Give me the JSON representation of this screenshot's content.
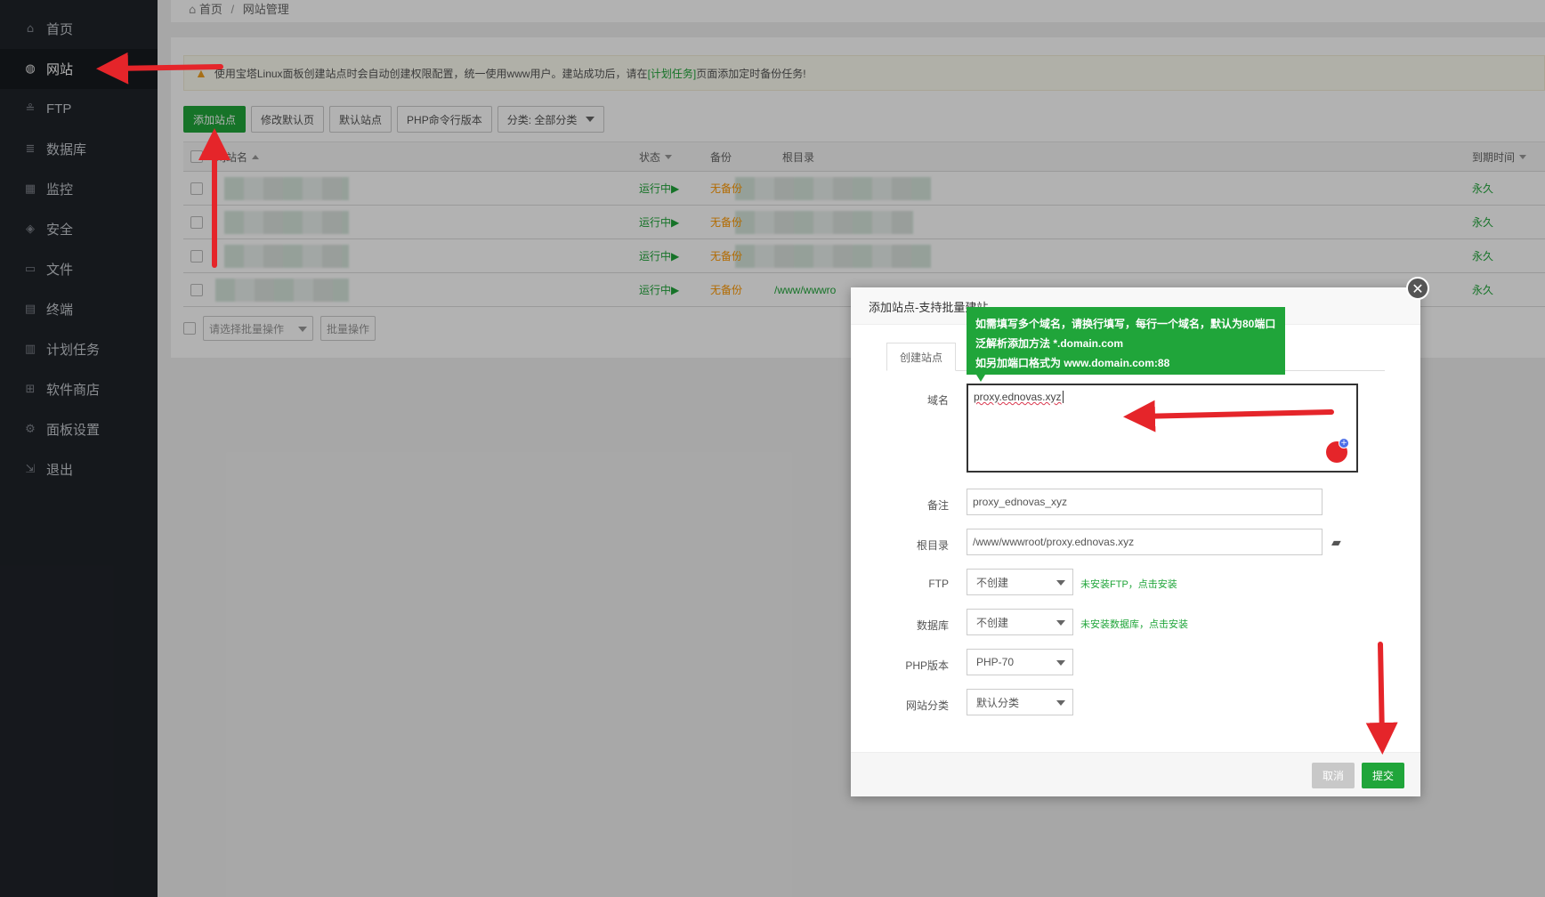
{
  "sidebar": {
    "items": [
      {
        "label": "首页",
        "icon": "home-icon",
        "glyph": "⌂"
      },
      {
        "label": "网站",
        "icon": "globe-icon",
        "glyph": "◍"
      },
      {
        "label": "FTP",
        "icon": "ftp-icon",
        "glyph": "≗"
      },
      {
        "label": "数据库",
        "icon": "database-icon",
        "glyph": "≣"
      },
      {
        "label": "监控",
        "icon": "monitor-icon",
        "glyph": "▦"
      },
      {
        "label": "安全",
        "icon": "shield-icon",
        "glyph": "◈"
      },
      {
        "label": "文件",
        "icon": "folder-icon",
        "glyph": "▭"
      },
      {
        "label": "终端",
        "icon": "terminal-icon",
        "glyph": "▤"
      },
      {
        "label": "计划任务",
        "icon": "calendar-icon",
        "glyph": "▥"
      },
      {
        "label": "软件商店",
        "icon": "grid-icon",
        "glyph": "⊞"
      },
      {
        "label": "面板设置",
        "icon": "gear-icon",
        "glyph": "⚙"
      },
      {
        "label": "退出",
        "icon": "logout-icon",
        "glyph": "⇲"
      }
    ],
    "active_index": 1
  },
  "breadcrumb": {
    "home": "首页",
    "sep": "/",
    "current": "网站管理"
  },
  "notice": {
    "text_before": "使用宝塔Linux面板创建站点时会自动创建权限配置，统一使用www用户。建站成功后，请在",
    "link": "[计划任务]",
    "text_after": "页面添加定时备份任务!"
  },
  "toolbar": {
    "add_site": "添加站点",
    "modify_default": "修改默认页",
    "default_site": "默认站点",
    "php_cli": "PHP命令行版本",
    "category": "分类: 全部分类"
  },
  "table": {
    "headers": {
      "name": "网站名",
      "status": "状态",
      "backup": "备份",
      "root": "根目录",
      "expire": "到期时间"
    },
    "rows": [
      {
        "status": "运行中▶",
        "backup": "无备份",
        "root": "",
        "expire": "永久"
      },
      {
        "status": "运行中▶",
        "backup": "无备份",
        "root": "",
        "expire": "永久"
      },
      {
        "status": "运行中▶",
        "backup": "无备份",
        "root": "",
        "expire": "永久"
      },
      {
        "status": "运行中▶",
        "backup": "无备份",
        "root": "/www/wwwro",
        "expire": "永久"
      }
    ]
  },
  "batch": {
    "select_placeholder": "请选择批量操作",
    "button": "批量操作"
  },
  "modal": {
    "title": "添加站点-支持批量建站",
    "close_glyph": "✕",
    "tab": "创建站点",
    "tooltip": [
      "如需填写多个域名，请换行填写，每行一个域名，默认为80端口",
      "泛解析添加方法 *.domain.com",
      "如另加端口格式为 www.domain.com:88"
    ],
    "domain_label": "域名",
    "domain_value": "proxy.ednovas.xyz",
    "note_label": "备注",
    "note_value": "proxy_ednovas_xyz",
    "root_label": "根目录",
    "root_value": "/www/wwwroot/proxy.ednovas.xyz",
    "ftp_label": "FTP",
    "ftp_value": "不创建",
    "ftp_hint": "未安装FTP，点击安装",
    "db_label": "数据库",
    "db_value": "不创建",
    "db_hint": "未安装数据库，点击安装",
    "php_label": "PHP版本",
    "php_value": "PHP-70",
    "cat_label": "网站分类",
    "cat_value": "默认分类",
    "cancel": "取消",
    "submit": "提交"
  },
  "colors": {
    "accent": "#20a53a",
    "sidebar": "#1f2329",
    "warning": "#ff9900",
    "annotation": "#e5252a"
  }
}
